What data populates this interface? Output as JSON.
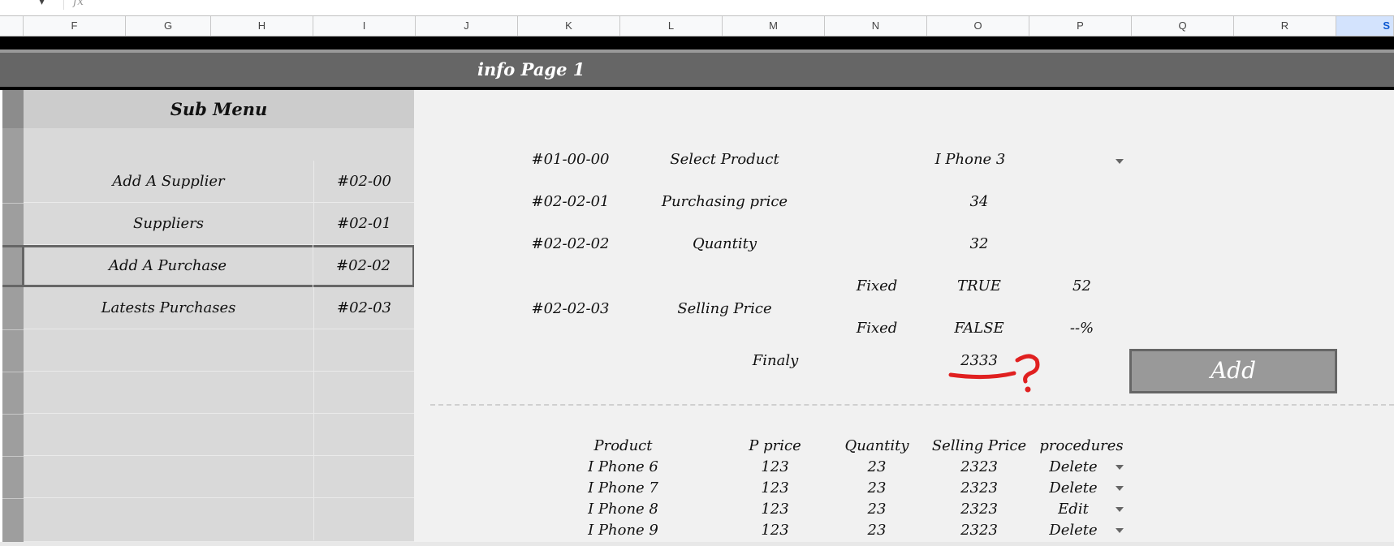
{
  "formula_bar": {
    "fx_label": "fx"
  },
  "columns": [
    "F",
    "G",
    "H",
    "I",
    "J",
    "K",
    "L",
    "M",
    "N",
    "O",
    "P",
    "Q",
    "R",
    "S"
  ],
  "selected_column": "S",
  "banner": {
    "title": "info Page 1"
  },
  "sub_menu": {
    "title": "Sub Menu",
    "items": [
      {
        "label": "Add A Supplier",
        "code": "#02-00"
      },
      {
        "label": "Suppliers",
        "code": "#02-01"
      },
      {
        "label": "Add A Purchase",
        "code": "#02-02"
      },
      {
        "label": "Latests Purchases",
        "code": "#02-03"
      }
    ]
  },
  "form": {
    "product": {
      "code": "#01-00-00",
      "label": "Select Product",
      "value": "I Phone 3"
    },
    "purchasing": {
      "code": "#02-02-01",
      "label": "Purchasing price",
      "value": "34"
    },
    "quantity": {
      "code": "#02-02-02",
      "label": "Quantity",
      "value": "32"
    },
    "selling": {
      "code": "#02-02-03",
      "label": "Selling Price",
      "fixed_label_1": "Fixed",
      "fixed_value_1": "TRUE",
      "fixed_amount_1": "52",
      "fixed_label_2": "Fixed",
      "fixed_value_2": "FALSE",
      "fixed_amount_2": "--%"
    },
    "finaly": {
      "label": "Finaly",
      "value": "2333",
      "annotation": "?"
    },
    "add_label": "Add"
  },
  "table": {
    "headers": [
      "Product",
      "P price",
      "Quantity",
      "Selling Price",
      "procedures"
    ],
    "rows": [
      [
        "I Phone 6",
        "123",
        "23",
        "2323",
        "Delete"
      ],
      [
        "I Phone 7",
        "123",
        "23",
        "2323",
        "Delete"
      ],
      [
        "I Phone 8",
        "123",
        "23",
        "2323",
        "Edit"
      ],
      [
        "I Phone 9",
        "123",
        "23",
        "2323",
        "Delete"
      ]
    ]
  },
  "colors": {
    "banner": "#666666",
    "button": "#999999",
    "annotation": "#e02020",
    "selected_column": "#d3e3fd"
  }
}
